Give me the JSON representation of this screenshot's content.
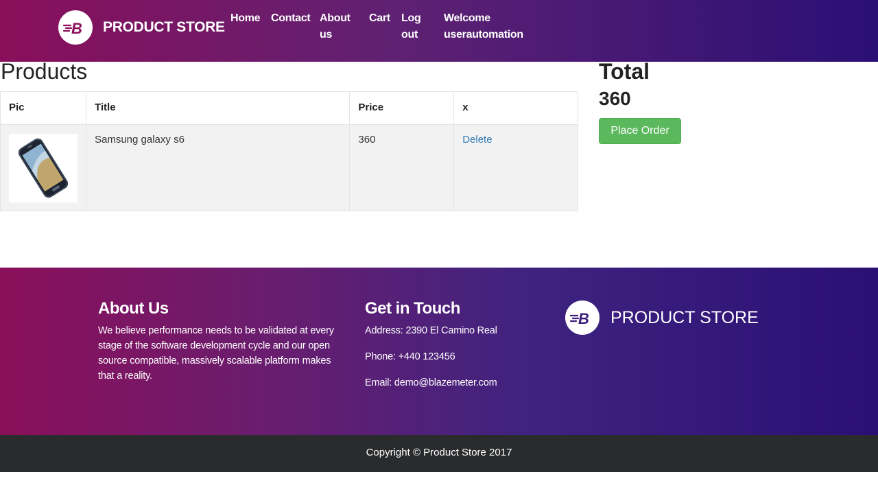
{
  "nav": {
    "brand": "PRODUCT STORE",
    "home": "Home",
    "contact": "Contact",
    "about_line1": "About",
    "about_line2": "us",
    "cart": "Cart",
    "logout_line1": "Log",
    "logout_line2": "out",
    "welcome_line1": "Welcome",
    "welcome_line2": "userautomation"
  },
  "products": {
    "title": "Products",
    "headers": [
      "Pic",
      "Title",
      "Price",
      "x"
    ],
    "rows": [
      {
        "title": "Samsung galaxy s6",
        "price": "360",
        "action": "Delete",
        "pic": "samsung-galaxy-s6-phone-image"
      }
    ]
  },
  "summary": {
    "title": "Total",
    "value": "360",
    "button": "Place Order"
  },
  "footer": {
    "about_title": "About Us",
    "about_text": "We believe performance needs to be validated at every stage of the software development cycle and our open source compatible, massively scalable platform makes that a reality.",
    "contact_title": "Get in Touch",
    "address": "Address: 2390 El Camino Real",
    "phone": "Phone: +440 123456",
    "email": "Email: demo@blazemeter.com",
    "brand": "PRODUCT STORE",
    "copyright": "Copyright © Product Store 2017"
  },
  "colors": {
    "gradient_start": "#8a0f5a",
    "gradient_end": "#2a0f75",
    "place_order": "#5cb85c",
    "link": "#337ab7",
    "copyright_bg": "#2a2b2d"
  }
}
